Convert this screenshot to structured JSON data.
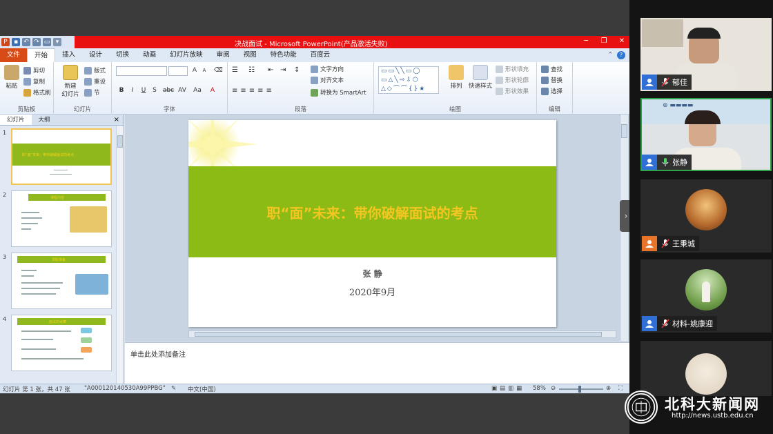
{
  "window": {
    "title": "决战面试 - Microsoft PowerPoint(产品激活失败)"
  },
  "tabs": [
    "文件",
    "开始",
    "插入",
    "设计",
    "切换",
    "动画",
    "幻灯片放映",
    "审阅",
    "视图",
    "特色功能",
    "百度云"
  ],
  "ribbon": {
    "clipboard": {
      "label": "剪贴板",
      "paste": "粘贴",
      "cut": "剪切",
      "copy": "复制",
      "format_painter": "格式刷"
    },
    "slides": {
      "label": "幻灯片",
      "new_slide": "新建",
      "new_slide2": "幻灯片",
      "layout": "版式",
      "reset": "重设",
      "section": "节"
    },
    "font": {
      "label": "字体",
      "bold": "B",
      "italic": "I",
      "underline": "U",
      "strike": "S",
      "abc": "abc",
      "spacing": "AV",
      "case": "Aa",
      "color": "A",
      "grow": "A",
      "shrink": "A"
    },
    "paragraph": {
      "label": "段落",
      "text_direction": "文字方向",
      "align_text": "对齐文本",
      "smartart": "转换为 SmartArt"
    },
    "drawing": {
      "label": "绘图",
      "arrange": "排列",
      "quick_styles": "快速样式",
      "fill": "形状填充",
      "outline": "形状轮廓",
      "effects": "形状效果"
    },
    "editing": {
      "label": "编辑",
      "find": "查找",
      "replace": "替换",
      "select": "选择"
    }
  },
  "left_panel": {
    "tab_slides": "幻灯片",
    "tab_outline": "大纲",
    "close": "×",
    "thumbs": [
      {
        "num": "1",
        "title": "职“面”未来：带你破解面试的考点"
      },
      {
        "num": "2",
        "title": "课程内容"
      },
      {
        "num": "3",
        "title": "求职准备"
      },
      {
        "num": "4",
        "title": "面试的考察"
      }
    ]
  },
  "slide": {
    "title": "职“面”未来：带你破解面试的考点",
    "author": "张 静",
    "date": "2020年9月"
  },
  "notes": {
    "placeholder": "单击此处添加备注"
  },
  "status": {
    "slide_info": "幻灯片 第 1 张，共 47 张",
    "theme": "\"A000120140530A99PPBG\"",
    "language": "中文(中国)",
    "zoom": "58%"
  },
  "participants": [
    {
      "name": "郁佳",
      "mic": "muted",
      "avatar_color": "#2f6fd6"
    },
    {
      "name": "张静",
      "mic": "active",
      "avatar_color": "#2f6fd6"
    },
    {
      "name": "王秉城",
      "mic": "muted",
      "avatar_color": "#e8742a"
    },
    {
      "name": "材料-姚康迎",
      "mic": "muted",
      "avatar_color": "#2f6fd6"
    },
    {
      "name": "",
      "mic": "none",
      "avatar_color": "#2f6fd6"
    }
  ],
  "watermark": {
    "title": "北科大新闻网",
    "url": "http://news.ustb.edu.cn"
  }
}
